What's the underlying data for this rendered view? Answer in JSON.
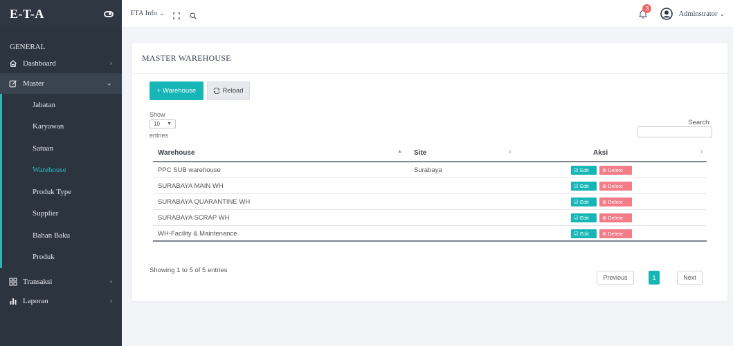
{
  "app": {
    "brand": "E-T-A"
  },
  "sidebar": {
    "section": "GENERAL",
    "dashboard": "Dashboard",
    "master": "Master",
    "submenu": [
      {
        "label": "Jabatan"
      },
      {
        "label": "Karyawan"
      },
      {
        "label": "Satuan"
      },
      {
        "label": "Warehouse",
        "active": true
      },
      {
        "label": "Produk Type"
      },
      {
        "label": "Supplier"
      },
      {
        "label": "Bahan Baku"
      },
      {
        "label": "Produk"
      }
    ],
    "transaksi": "Transaksi",
    "laporan": "Laporan"
  },
  "topbar": {
    "menu": "ETA Info",
    "notif_count": "3",
    "user": "Adminstrator"
  },
  "page": {
    "title": "MASTER WAREHOUSE",
    "add_button": "+ Warehouse",
    "reload_button": "Reload",
    "show_label": "Show",
    "entries_value": "10",
    "entries_label": "entries",
    "search_label": "Search:",
    "search_value": ""
  },
  "table": {
    "columns": [
      "Warehouse",
      "Site",
      "Aksi"
    ],
    "rows": [
      {
        "warehouse": "PPC SUB warehouse",
        "site": "Surabaya"
      },
      {
        "warehouse": "SURABAYA MAIN WH",
        "site": ""
      },
      {
        "warehouse": "SURABAYA QUARANTINE WH",
        "site": ""
      },
      {
        "warehouse": "SURABAYA SCRAP WH",
        "site": ""
      },
      {
        "warehouse": "WH-Facility & Maintenance",
        "site": ""
      }
    ],
    "edit_label": "Edit",
    "delete_label": "Delete"
  },
  "footer": {
    "info": "Showing 1 to 5 of 5 entries",
    "previous": "Previous",
    "current_page": "1",
    "next": "Next"
  },
  "colors": {
    "accent": "#16b6b6",
    "sidebar_bg": "#2c3440",
    "delete": "#f47b88",
    "badge": "#f06a67"
  }
}
